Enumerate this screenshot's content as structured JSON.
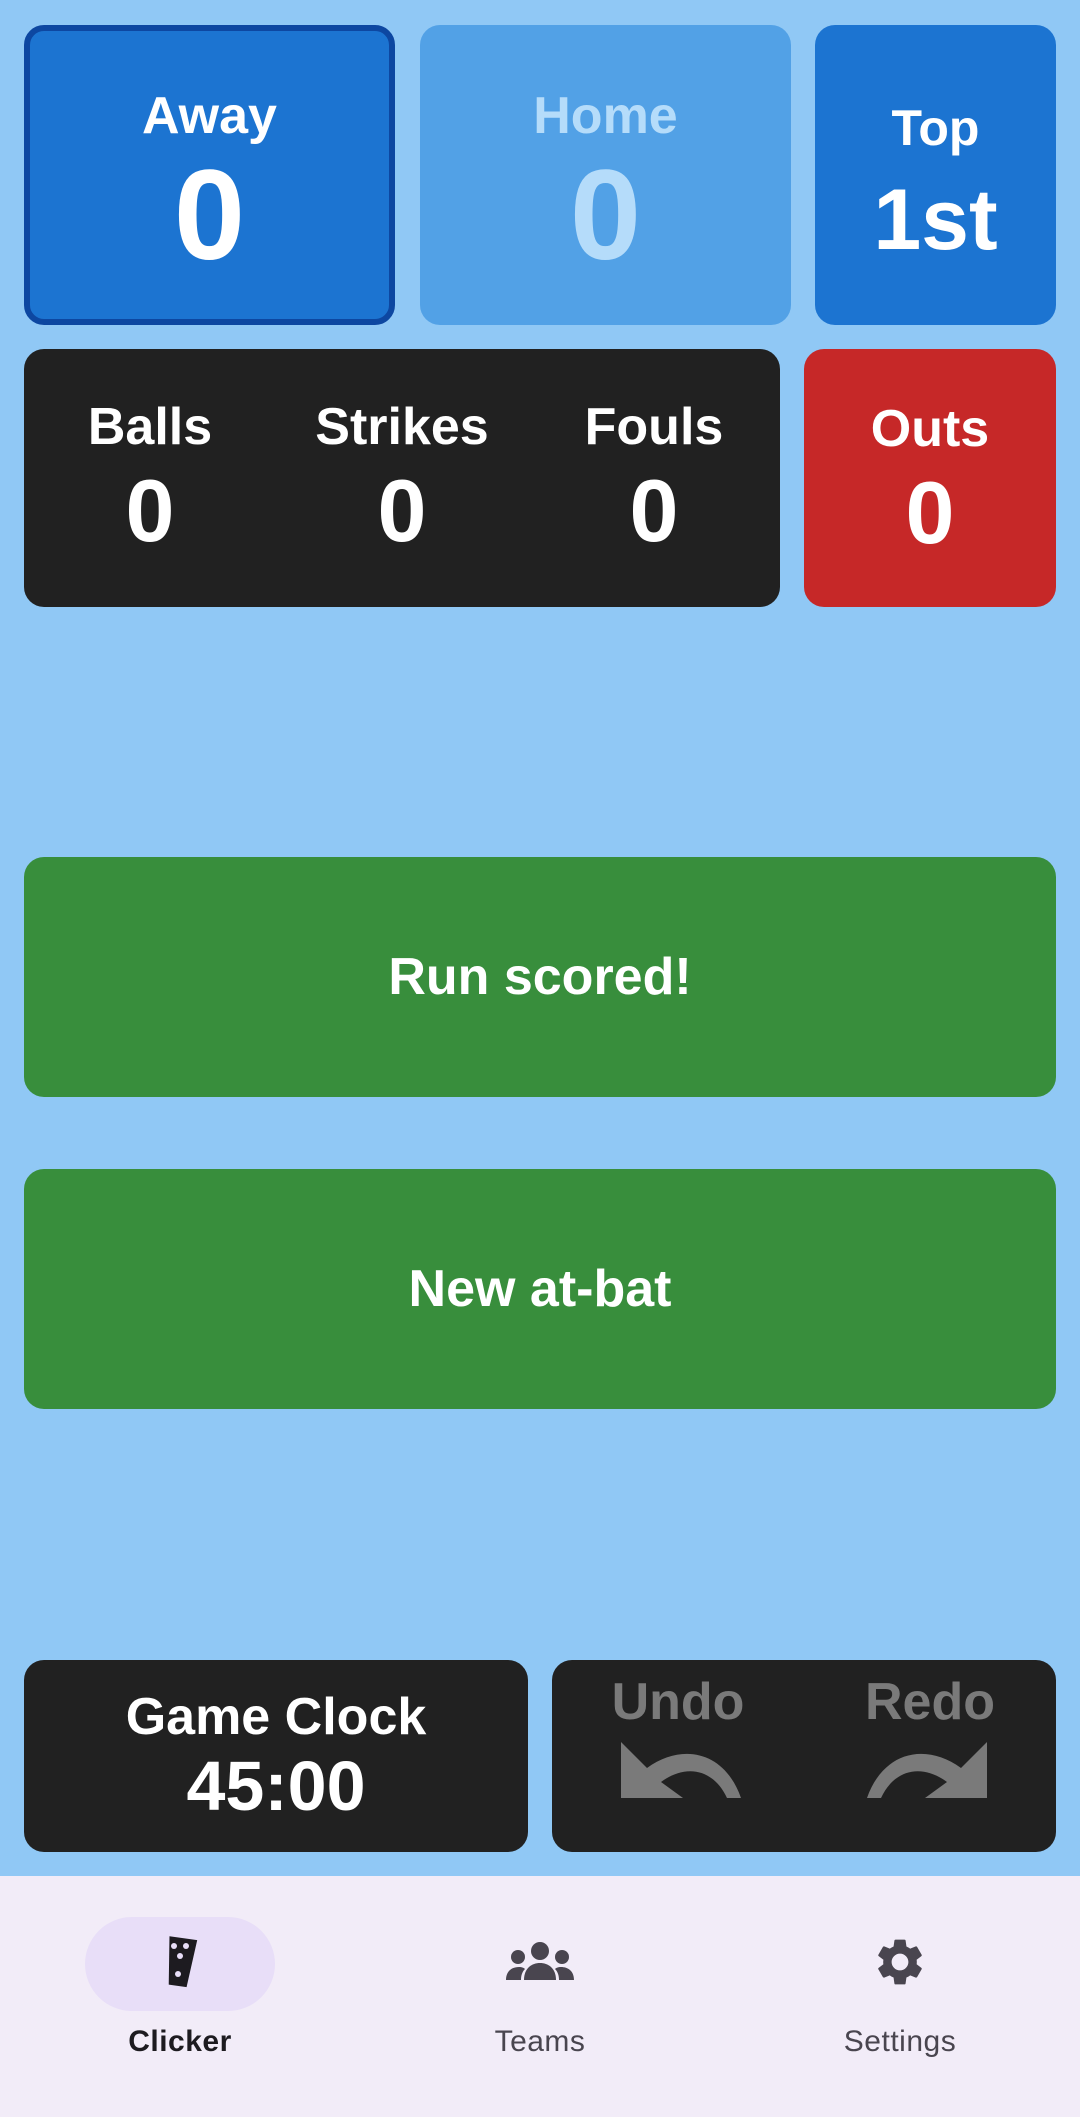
{
  "scoreboard": {
    "away": {
      "label": "Away",
      "score": "0"
    },
    "home": {
      "label": "Home",
      "score": "0"
    },
    "inning": {
      "half": "Top",
      "number": "1st"
    }
  },
  "count": {
    "balls": {
      "label": "Balls",
      "value": "0"
    },
    "strikes": {
      "label": "Strikes",
      "value": "0"
    },
    "fouls": {
      "label": "Fouls",
      "value": "0"
    },
    "outs": {
      "label": "Outs",
      "value": "0"
    }
  },
  "actions": {
    "run_scored": "Run scored!",
    "new_at_bat": "New at-bat"
  },
  "clock": {
    "label": "Game Clock",
    "time": "45:00"
  },
  "history": {
    "undo": "Undo",
    "redo": "Redo"
  },
  "nav": {
    "items": [
      {
        "label": "Clicker",
        "icon": "clicker-icon",
        "active": true
      },
      {
        "label": "Teams",
        "icon": "people-icon",
        "active": false
      },
      {
        "label": "Settings",
        "icon": "gear-icon",
        "active": false
      }
    ]
  },
  "colors": {
    "background": "#90c8f5",
    "team_active": "#1c74d1",
    "team_inactive": "#52a1e6",
    "panel_dark": "#212121",
    "outs": "#c62828",
    "action_green": "#388e3c",
    "nav_bg": "#f2ecf8"
  }
}
